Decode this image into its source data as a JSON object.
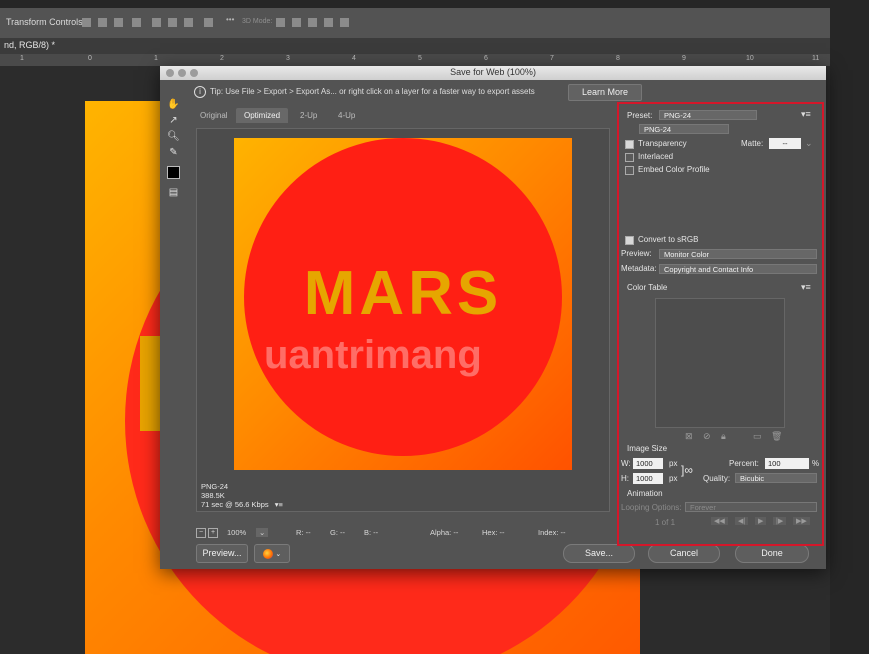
{
  "options_bar": {
    "label": "Transform Controls",
    "mode_label": "3D Mode:"
  },
  "document_tab": {
    "title": "nd, RGB/8) *"
  },
  "ruler": {
    "numbers": [
      "1",
      "0",
      "1",
      "2",
      "3",
      "4",
      "5",
      "6",
      "7",
      "8",
      "9",
      "10",
      "11"
    ]
  },
  "dialog": {
    "title": "Save for Web (100%)",
    "tip": "Tip: Use File > Export > Export As...  or right click on a layer for a faster way to export assets",
    "learn_more": "Learn More",
    "tabs": [
      "Original",
      "Optimized",
      "2-Up",
      "4-Up"
    ],
    "active_tab": "Optimized",
    "preview_text": "MARS",
    "watermark": "uantrimang",
    "preview_info": {
      "format": "PNG-24",
      "size": "388.5K",
      "time": "71 sec @ 56.6 Kbps"
    },
    "status": {
      "zoom": "100%",
      "r": "R: --",
      "g": "G: --",
      "b": "B: --",
      "alpha": "Alpha: --",
      "hex": "Hex: --",
      "index": "Index: --"
    },
    "buttons": {
      "preview": "Preview...",
      "save": "Save...",
      "cancel": "Cancel",
      "done": "Done"
    },
    "settings": {
      "preset_label": "Preset:",
      "preset_value": "PNG-24",
      "format_value": "PNG-24",
      "transparency": "Transparency",
      "matte_label": "Matte:",
      "matte_value": "--",
      "interlaced": "Interlaced",
      "embed_color_profile": "Embed Color Profile",
      "convert_srgb": "Convert to sRGB",
      "preview_label": "Preview:",
      "preview_value": "Monitor Color",
      "metadata_label": "Metadata:",
      "metadata_value": "Copyright and Contact Info",
      "color_table": "Color Table",
      "image_size": "Image Size",
      "w_label": "W:",
      "w_value": "1000",
      "h_label": "H:",
      "h_value": "1000",
      "px": "px",
      "percent_label": "Percent:",
      "percent_value": "100",
      "percent_sign": "%",
      "quality_label": "Quality:",
      "quality_value": "Bicubic",
      "animation": "Animation",
      "looping_label": "Looping Options:",
      "looping_value": "Forever",
      "frame": "1 of 1"
    },
    "checked": {
      "transparency": true,
      "interlaced": false,
      "embed_color_profile": false,
      "convert_srgb": true
    },
    "highlight_color": "#d4172a"
  }
}
